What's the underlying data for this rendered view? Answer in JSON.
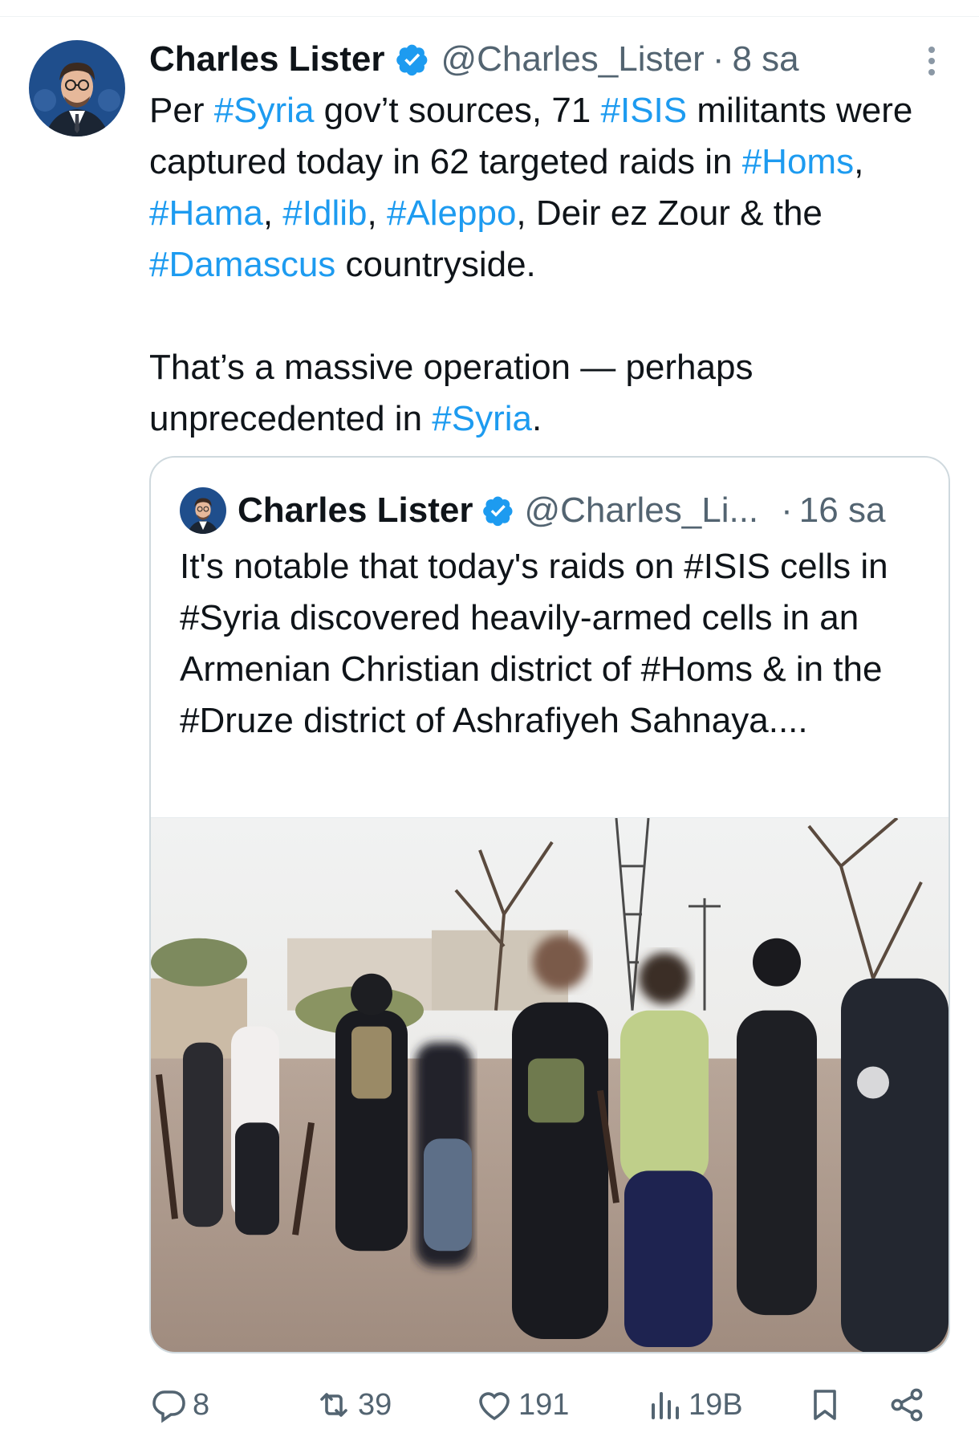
{
  "tweet": {
    "author_name": "Charles Lister",
    "handle": "@Charles_Lister",
    "separator": "·",
    "time": "8 sa",
    "paragraph1": [
      {
        "t": "Per ",
        "tag": false
      },
      {
        "t": "#Syria",
        "tag": true
      },
      {
        "t": " gov’t sources, 71 ",
        "tag": false
      },
      {
        "t": "#ISIS",
        "tag": true
      },
      {
        "t": " militants were captured today in 62 targeted raids in ",
        "tag": false
      },
      {
        "t": "#Homs",
        "tag": true
      },
      {
        "t": ", ",
        "tag": false
      },
      {
        "t": "#Hama",
        "tag": true
      },
      {
        "t": ", ",
        "tag": false
      },
      {
        "t": "#Idlib",
        "tag": true
      },
      {
        "t": ", ",
        "tag": false
      },
      {
        "t": "#Aleppo",
        "tag": true
      },
      {
        "t": ", Deir ez Zour & the ",
        "tag": false
      },
      {
        "t": "#Damascus",
        "tag": true
      },
      {
        "t": " countryside.",
        "tag": false
      }
    ],
    "paragraph2": [
      {
        "t": "That’s a massive operation — perhaps unprecedented in ",
        "tag": false
      },
      {
        "t": "#Syria",
        "tag": true
      },
      {
        "t": ".",
        "tag": false
      }
    ]
  },
  "quoted": {
    "author_name": "Charles Lister",
    "handle": "@Charles_Li...",
    "separator": "·",
    "time": "16 sa",
    "text": "It's notable that today's raids on #ISIS cells in #Syria discovered heavily-armed cells in an Armenian Christian district of #Homs & in the #Druze district of Ashrafiyeh Sahnaya...."
  },
  "actions": {
    "replies": "8",
    "reposts": "39",
    "likes": "191",
    "views": "19B"
  },
  "icons": {
    "verified": "verified-badge-icon",
    "more": "more-vertical-icon",
    "reply": "reply-icon",
    "repost": "repost-icon",
    "like": "heart-icon",
    "views": "views-icon",
    "bookmark": "bookmark-icon",
    "share": "share-icon"
  },
  "colors": {
    "link": "#1d9bf0",
    "text": "#0f1419",
    "muted": "#536471",
    "border": "#cfd9de"
  }
}
